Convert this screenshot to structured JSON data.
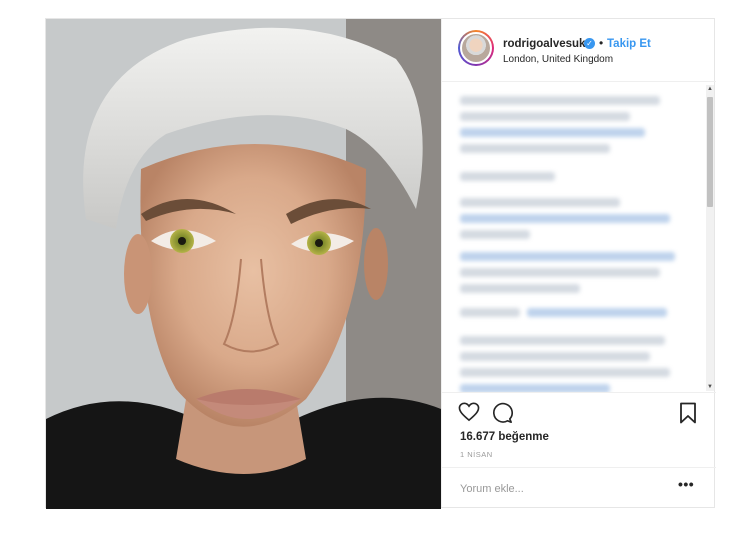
{
  "post": {
    "username": "rodrigoalvesuk",
    "follow_label": "Takip Et",
    "separator": "•",
    "location": "London, United Kingdom",
    "likes": "16.677 beğenme",
    "date": "1 NİSAN"
  },
  "comment": {
    "placeholder": "Yorum ekle...",
    "more_label": "•••"
  },
  "icons": {
    "verified": "verified-badge-icon",
    "like": "heart-icon",
    "comment": "speech-bubble-icon",
    "save": "bookmark-icon"
  },
  "colors": {
    "link": "#3897f0",
    "text": "#262626",
    "muted": "#999999",
    "border": "#efefef"
  }
}
